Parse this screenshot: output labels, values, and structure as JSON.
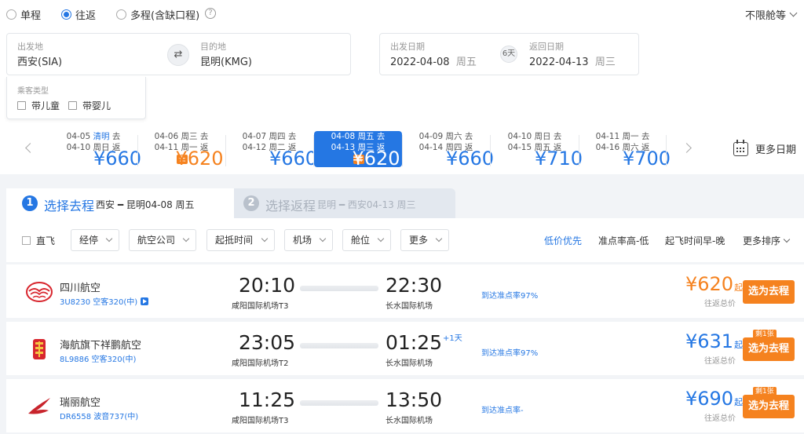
{
  "trip_types": [
    "单程",
    "往返",
    "多程(含缺口程)"
  ],
  "selected_trip_type": "往返",
  "cabin_class": "不限舱等",
  "search": {
    "origin_label": "出发地",
    "origin": "西安(SIA)",
    "dest_label": "目的地",
    "dest": "昆明(KMG)",
    "depart_label": "出发日期",
    "depart_date": "2022-04-08",
    "depart_weekday": "周五",
    "return_label": "返回日期",
    "return_date": "2022-04-13",
    "return_weekday": "周三",
    "trip_days": "6天"
  },
  "passengers": {
    "label": "乘客类型",
    "child": "带儿童",
    "infant": "带婴儿"
  },
  "date_strip": [
    {
      "go": "04-05",
      "go_tag": "清明",
      "go_tag_holiday": true,
      "go_suffix": "去",
      "back": "04-10",
      "back_day": "周日",
      "back_suffix": "返",
      "price": "¥660",
      "low": ""
    },
    {
      "go": "04-06",
      "go_tag": "周三",
      "go_tag_holiday": false,
      "go_suffix": "去",
      "back": "04-11",
      "back_day": "周一",
      "back_suffix": "返",
      "price": "¥620",
      "low": "低"
    },
    {
      "go": "04-07",
      "go_tag": "周四",
      "go_tag_holiday": false,
      "go_suffix": "去",
      "back": "04-12",
      "back_day": "周二",
      "back_suffix": "返",
      "price": "¥660",
      "low": ""
    },
    {
      "go": "04-08",
      "go_tag": "周五",
      "go_tag_holiday": false,
      "go_suffix": "去",
      "back": "04-13",
      "back_day": "周三",
      "back_suffix": "返",
      "price": "¥620",
      "low": "低"
    },
    {
      "go": "04-09",
      "go_tag": "周六",
      "go_tag_holiday": false,
      "go_suffix": "去",
      "back": "04-14",
      "back_day": "周四",
      "back_suffix": "返",
      "price": "¥660",
      "low": ""
    },
    {
      "go": "04-10",
      "go_tag": "周日",
      "go_tag_holiday": false,
      "go_suffix": "去",
      "back": "04-15",
      "back_day": "周五",
      "back_suffix": "返",
      "price": "¥710",
      "low": ""
    },
    {
      "go": "04-11",
      "go_tag": "周一",
      "go_tag_holiday": false,
      "go_suffix": "去",
      "back": "04-16",
      "back_day": "周六",
      "back_suffix": "返",
      "price": "¥700",
      "low": ""
    }
  ],
  "more_dates": "更多日期",
  "steps": {
    "step1_num": "1",
    "step1_title": "选择去程",
    "step1_sub": "西安 ━ 昆明04-08 周五",
    "step2_num": "2",
    "step2_title": "选择返程",
    "step2_sub": "昆明 ━ 西安04-13 周三"
  },
  "filters": {
    "direct": "直飞",
    "dropdowns": [
      "经停",
      "航空公司",
      "起抵时间",
      "机场",
      "舱位",
      "更多"
    ],
    "sorts": [
      "低价优先",
      "准点率高-低",
      "起飞时间早-晚",
      "更多排序"
    ]
  },
  "flights": [
    {
      "airline": "四川航空",
      "info": "3U8230 空客320(中)",
      "dep_time": "20:10",
      "dep_apt": "咸阳国际机场T3",
      "arr_time": "22:30",
      "arr_apt": "长水国际机场",
      "plus_day": "",
      "ontime": "到达准点率97%",
      "price": "¥620",
      "price_suffix": "起",
      "price_note": "往返总价",
      "price_color": "#f5821f",
      "badge": "",
      "button": "选为去程",
      "logo_color": "#d8262e"
    },
    {
      "airline": "海航旗下祥鹏航空",
      "info": "8L9886 空客320(中)",
      "dep_time": "23:05",
      "dep_apt": "咸阳国际机场T2",
      "arr_time": "01:25",
      "arr_apt": "长水国际机场",
      "plus_day": "+1天",
      "ontime": "到达准点率97%",
      "price": "¥631",
      "price_suffix": "起",
      "price_note": "往返总价",
      "price_color": "#2577e3",
      "badge": "剩1张",
      "button": "选为去程",
      "logo_color": "#d8262e"
    },
    {
      "airline": "瑞丽航空",
      "info": "DR6558 波音737(中)",
      "dep_time": "11:25",
      "dep_apt": "咸阳国际机场T3",
      "arr_time": "13:50",
      "arr_apt": "长水国际机场",
      "plus_day": "",
      "ontime": "到达准点率-",
      "price": "¥690",
      "price_suffix": "起",
      "price_note": "往返总价",
      "price_color": "#2577e3",
      "badge": "剩1张",
      "button": "选为去程",
      "logo_color": "#c8242c"
    }
  ]
}
